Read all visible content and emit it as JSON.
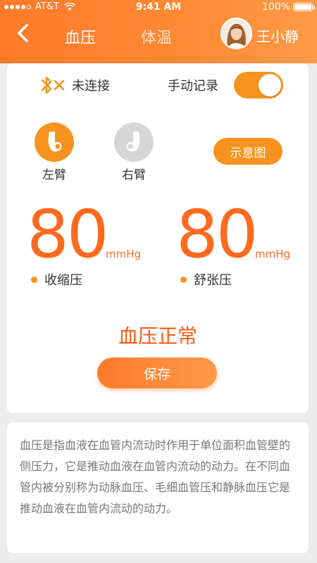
{
  "status_bar": {
    "carrier": "AT&T",
    "time": "9:41 AM",
    "battery": "100%",
    "battery_level": 1.0
  },
  "nav": {
    "tabs": [
      {
        "label": "血压",
        "active": true
      },
      {
        "label": "体温",
        "active": false
      }
    ],
    "user_name": "王小静"
  },
  "device": {
    "bluetooth_status": "未连接",
    "manual_record_label": "手动记录",
    "manual_record_on": true
  },
  "arms": {
    "left": {
      "label": "左臂",
      "selected": true
    },
    "right": {
      "label": "右臂",
      "selected": false
    }
  },
  "diagram_button": "示意图",
  "readings": {
    "systolic": {
      "value": "80",
      "unit": "mmHg",
      "label": "收缩压"
    },
    "diastolic": {
      "value": "80",
      "unit": "mmHg",
      "label": "舒张压"
    }
  },
  "result": "血压正常",
  "save_button": "保存",
  "info_text": "血压是指血液在血管内流动时作用于单位面积血管壁的侧压力，它是推动血液在血管内流动的动力。在不同血管内被分别称为动脉血压、毛细血管压和静脉血压它是推动血液在血管内流动的动力。",
  "colors": {
    "accent": "#f7931e",
    "header": "#ff7a2a",
    "reading": "#ff6a1f",
    "result": "#ff5a10"
  },
  "icons": [
    "back-arrow-icon",
    "bluetooth-off-icon",
    "left-arm-icon",
    "right-arm-icon",
    "wifi-icon",
    "battery-icon"
  ]
}
